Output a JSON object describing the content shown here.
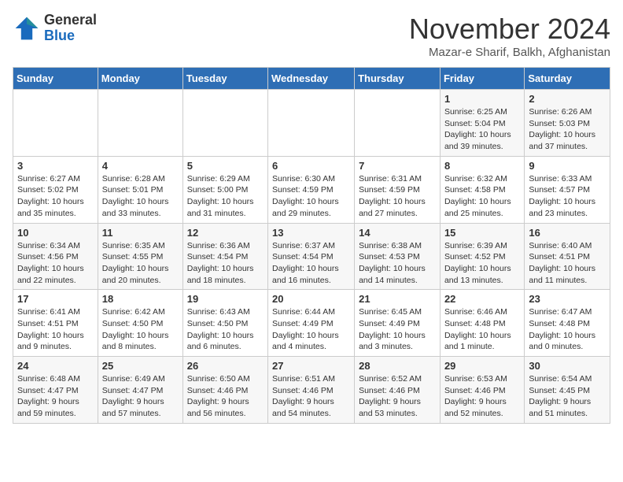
{
  "header": {
    "logo_general": "General",
    "logo_blue": "Blue",
    "month_title": "November 2024",
    "subtitle": "Mazar-e Sharif, Balkh, Afghanistan"
  },
  "weekdays": [
    "Sunday",
    "Monday",
    "Tuesday",
    "Wednesday",
    "Thursday",
    "Friday",
    "Saturday"
  ],
  "weeks": [
    [
      {
        "day": "",
        "info": ""
      },
      {
        "day": "",
        "info": ""
      },
      {
        "day": "",
        "info": ""
      },
      {
        "day": "",
        "info": ""
      },
      {
        "day": "",
        "info": ""
      },
      {
        "day": "1",
        "info": "Sunrise: 6:25 AM\nSunset: 5:04 PM\nDaylight: 10 hours and 39 minutes."
      },
      {
        "day": "2",
        "info": "Sunrise: 6:26 AM\nSunset: 5:03 PM\nDaylight: 10 hours and 37 minutes."
      }
    ],
    [
      {
        "day": "3",
        "info": "Sunrise: 6:27 AM\nSunset: 5:02 PM\nDaylight: 10 hours and 35 minutes."
      },
      {
        "day": "4",
        "info": "Sunrise: 6:28 AM\nSunset: 5:01 PM\nDaylight: 10 hours and 33 minutes."
      },
      {
        "day": "5",
        "info": "Sunrise: 6:29 AM\nSunset: 5:00 PM\nDaylight: 10 hours and 31 minutes."
      },
      {
        "day": "6",
        "info": "Sunrise: 6:30 AM\nSunset: 4:59 PM\nDaylight: 10 hours and 29 minutes."
      },
      {
        "day": "7",
        "info": "Sunrise: 6:31 AM\nSunset: 4:59 PM\nDaylight: 10 hours and 27 minutes."
      },
      {
        "day": "8",
        "info": "Sunrise: 6:32 AM\nSunset: 4:58 PM\nDaylight: 10 hours and 25 minutes."
      },
      {
        "day": "9",
        "info": "Sunrise: 6:33 AM\nSunset: 4:57 PM\nDaylight: 10 hours and 23 minutes."
      }
    ],
    [
      {
        "day": "10",
        "info": "Sunrise: 6:34 AM\nSunset: 4:56 PM\nDaylight: 10 hours and 22 minutes."
      },
      {
        "day": "11",
        "info": "Sunrise: 6:35 AM\nSunset: 4:55 PM\nDaylight: 10 hours and 20 minutes."
      },
      {
        "day": "12",
        "info": "Sunrise: 6:36 AM\nSunset: 4:54 PM\nDaylight: 10 hours and 18 minutes."
      },
      {
        "day": "13",
        "info": "Sunrise: 6:37 AM\nSunset: 4:54 PM\nDaylight: 10 hours and 16 minutes."
      },
      {
        "day": "14",
        "info": "Sunrise: 6:38 AM\nSunset: 4:53 PM\nDaylight: 10 hours and 14 minutes."
      },
      {
        "day": "15",
        "info": "Sunrise: 6:39 AM\nSunset: 4:52 PM\nDaylight: 10 hours and 13 minutes."
      },
      {
        "day": "16",
        "info": "Sunrise: 6:40 AM\nSunset: 4:51 PM\nDaylight: 10 hours and 11 minutes."
      }
    ],
    [
      {
        "day": "17",
        "info": "Sunrise: 6:41 AM\nSunset: 4:51 PM\nDaylight: 10 hours and 9 minutes."
      },
      {
        "day": "18",
        "info": "Sunrise: 6:42 AM\nSunset: 4:50 PM\nDaylight: 10 hours and 8 minutes."
      },
      {
        "day": "19",
        "info": "Sunrise: 6:43 AM\nSunset: 4:50 PM\nDaylight: 10 hours and 6 minutes."
      },
      {
        "day": "20",
        "info": "Sunrise: 6:44 AM\nSunset: 4:49 PM\nDaylight: 10 hours and 4 minutes."
      },
      {
        "day": "21",
        "info": "Sunrise: 6:45 AM\nSunset: 4:49 PM\nDaylight: 10 hours and 3 minutes."
      },
      {
        "day": "22",
        "info": "Sunrise: 6:46 AM\nSunset: 4:48 PM\nDaylight: 10 hours and 1 minute."
      },
      {
        "day": "23",
        "info": "Sunrise: 6:47 AM\nSunset: 4:48 PM\nDaylight: 10 hours and 0 minutes."
      }
    ],
    [
      {
        "day": "24",
        "info": "Sunrise: 6:48 AM\nSunset: 4:47 PM\nDaylight: 9 hours and 59 minutes."
      },
      {
        "day": "25",
        "info": "Sunrise: 6:49 AM\nSunset: 4:47 PM\nDaylight: 9 hours and 57 minutes."
      },
      {
        "day": "26",
        "info": "Sunrise: 6:50 AM\nSunset: 4:46 PM\nDaylight: 9 hours and 56 minutes."
      },
      {
        "day": "27",
        "info": "Sunrise: 6:51 AM\nSunset: 4:46 PM\nDaylight: 9 hours and 54 minutes."
      },
      {
        "day": "28",
        "info": "Sunrise: 6:52 AM\nSunset: 4:46 PM\nDaylight: 9 hours and 53 minutes."
      },
      {
        "day": "29",
        "info": "Sunrise: 6:53 AM\nSunset: 4:46 PM\nDaylight: 9 hours and 52 minutes."
      },
      {
        "day": "30",
        "info": "Sunrise: 6:54 AM\nSunset: 4:45 PM\nDaylight: 9 hours and 51 minutes."
      }
    ]
  ]
}
